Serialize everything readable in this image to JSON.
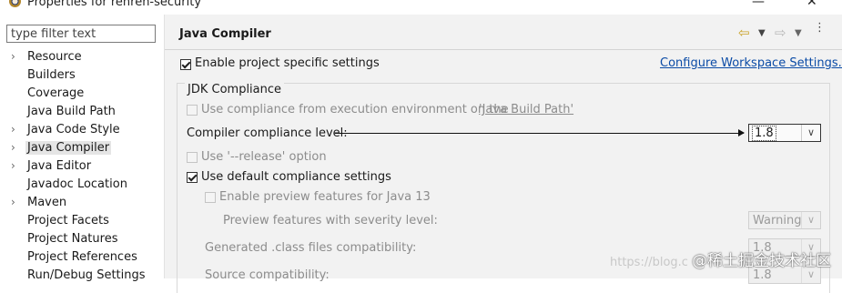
{
  "window": {
    "title": "Properties for renren-security",
    "minimize": "—",
    "close": "✕"
  },
  "filter": {
    "placeholder": "type filter text"
  },
  "tree": [
    {
      "label": "Resource",
      "expandable": true
    },
    {
      "label": "Builders",
      "expandable": false
    },
    {
      "label": "Coverage",
      "expandable": false
    },
    {
      "label": "Java Build Path",
      "expandable": false
    },
    {
      "label": "Java Code Style",
      "expandable": true
    },
    {
      "label": "Java Compiler",
      "expandable": true,
      "selected": true
    },
    {
      "label": "Java Editor",
      "expandable": true
    },
    {
      "label": "Javadoc Location",
      "expandable": false
    },
    {
      "label": "Maven",
      "expandable": true
    },
    {
      "label": "Project Facets",
      "expandable": false
    },
    {
      "label": "Project Natures",
      "expandable": false
    },
    {
      "label": "Project References",
      "expandable": false
    },
    {
      "label": "Run/Debug Settings",
      "expandable": false
    }
  ],
  "page": {
    "title": "Java Compiler",
    "enable_specific": {
      "label": "Enable project specific settings",
      "checked": true
    },
    "configure_link": "Configure Workspace Settings...",
    "jdk_group_title": "JDK Compliance",
    "use_env": {
      "label_pre": "Use compliance from execution environment on the ",
      "link": "'Java Build Path'",
      "checked": false,
      "enabled": false
    },
    "compliance_label": "Compiler compliance level:",
    "compliance_value": "1.8",
    "use_release": {
      "label": "Use '--release' option",
      "checked": false,
      "enabled": false
    },
    "use_default": {
      "label": "Use default compliance settings",
      "checked": true
    },
    "enable_preview": {
      "label": "Enable preview features for Java 13",
      "checked": false,
      "enabled": false
    },
    "preview_severity_label": "Preview features with severity level:",
    "preview_severity_value": "Warning",
    "generated_label": "Generated .class files compatibility:",
    "generated_value": "1.8",
    "source_label": "Source compatibility:",
    "source_value": "1.8"
  },
  "watermark": {
    "url": "https://blog.c",
    "text": "@稀土掘金技术社区"
  }
}
